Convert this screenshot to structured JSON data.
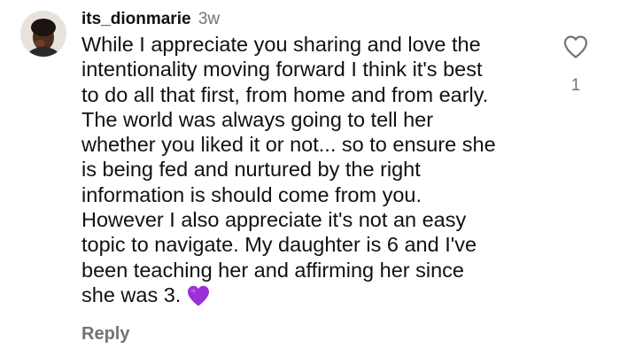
{
  "comment": {
    "username": "its_dionmarie",
    "time_ago": "3w",
    "text_lines": [
      "While I appreciate you sharing and love the",
      "intentionality moving forward I think it's best",
      "to do all that first, from home and from early.",
      "The world was always going to tell her",
      "whether you liked it or not... so to ensure she",
      "is being fed and nurtured by the right",
      "information is should come from you.",
      "However I also appreciate it's not an easy",
      "topic to navigate. My daughter is 6 and I've",
      "been teaching her and affirming her since",
      "she was 3."
    ],
    "emoji": "purple-heart",
    "like_count": "1",
    "reply_label": "Reply",
    "like_icon": "heart-outline-icon",
    "colors": {
      "text": "#111111",
      "secondary": "#737373",
      "emoji": "#9b30d9"
    }
  }
}
